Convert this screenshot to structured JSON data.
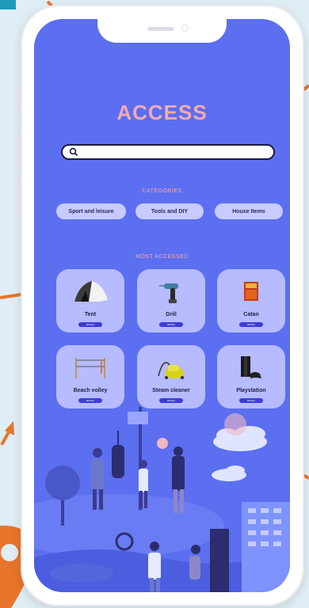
{
  "app": {
    "title": "ACCESS"
  },
  "search": {
    "placeholder": "",
    "value": ""
  },
  "categories": {
    "heading": "CATEGORIES",
    "items": [
      "Sport and leisure",
      "Tools and DIY",
      "House Items"
    ]
  },
  "most_accessed": {
    "heading": "MOST ACCESSED",
    "items": [
      {
        "name": "Tent",
        "button": "DETAILS"
      },
      {
        "name": "Drill",
        "button": "DETAILS"
      },
      {
        "name": "Catan",
        "button": "DETAILS"
      },
      {
        "name": "Beach volley",
        "button": "DETAILS"
      },
      {
        "name": "Steam cleaner",
        "button": "DETAILS"
      },
      {
        "name": "Playstation",
        "button": "DETAILS"
      }
    ]
  },
  "colors": {
    "screen_bg": "#5b6ff0",
    "title": "#f7a9b0",
    "card_bg": "#b7bbff",
    "category_bg": "#c7cbff",
    "button": "#3d3cd8",
    "annotation_arrow": "#e8742b"
  }
}
